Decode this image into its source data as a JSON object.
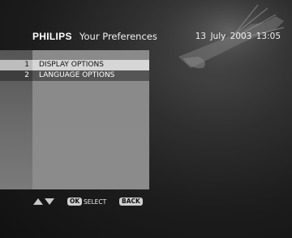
{
  "header": {
    "brand": "PHILIPS",
    "title": "Your Preferences",
    "date": "13 July 2003",
    "time": "13:05"
  },
  "menu": {
    "items": [
      {
        "number": "1",
        "label": "DISPLAY OPTIONS",
        "selected": true
      },
      {
        "number": "2",
        "label": "LANGUAGE OPTIONS",
        "selected": false
      }
    ]
  },
  "controls": {
    "navigate_icon": "up-down-arrows-icon",
    "ok_label": "OK",
    "select_label": "SELECT",
    "back_label": "BACK"
  },
  "colors": {
    "panel": "#8a8a8a",
    "selected_row": "#d6d6d6",
    "background": "#1c1c1c"
  }
}
